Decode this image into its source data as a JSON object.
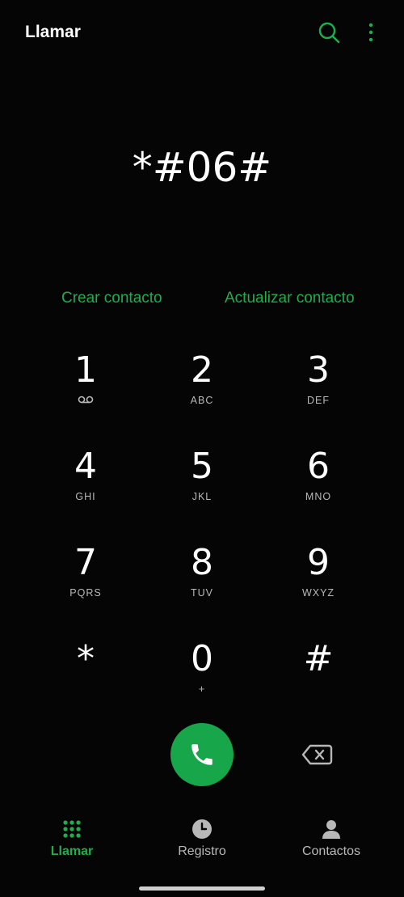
{
  "header": {
    "title": "Llamar",
    "search_icon": "search-icon",
    "more_icon": "more-vert-icon",
    "accent": "#1fae4a"
  },
  "dial": {
    "number": "*#06#"
  },
  "actions": {
    "create": "Crear contacto",
    "update": "Actualizar contacto"
  },
  "keypad": {
    "keys": [
      {
        "digit": "1",
        "letters": ""
      },
      {
        "digit": "2",
        "letters": "ABC"
      },
      {
        "digit": "3",
        "letters": "DEF"
      },
      {
        "digit": "4",
        "letters": "GHI"
      },
      {
        "digit": "5",
        "letters": "JKL"
      },
      {
        "digit": "6",
        "letters": "MNO"
      },
      {
        "digit": "7",
        "letters": "PQRS"
      },
      {
        "digit": "8",
        "letters": "TUV"
      },
      {
        "digit": "9",
        "letters": "WXYZ"
      },
      {
        "digit": "*",
        "letters": ""
      },
      {
        "digit": "0",
        "letters": "+"
      },
      {
        "digit": "#",
        "letters": ""
      }
    ]
  },
  "bottom_nav": {
    "items": [
      {
        "label": "Llamar",
        "icon": "dialpad-icon"
      },
      {
        "label": "Registro",
        "icon": "clock-icon"
      },
      {
        "label": "Contactos",
        "icon": "person-icon"
      }
    ],
    "active_index": 0
  }
}
